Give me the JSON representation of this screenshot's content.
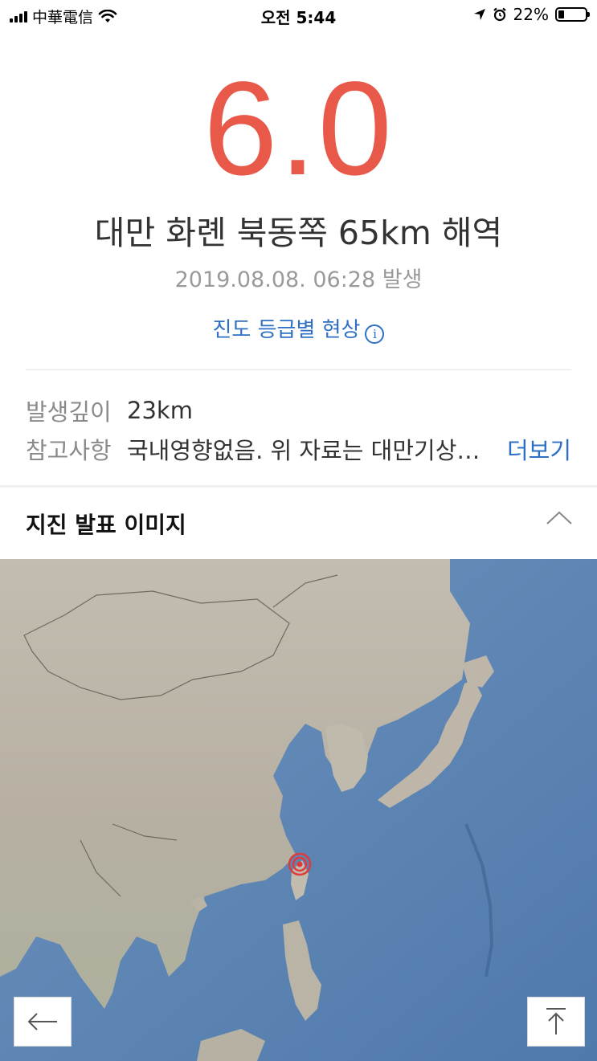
{
  "status_bar": {
    "carrier": "中華電信",
    "time": "오전 5:44",
    "battery": "22%",
    "battery_level": 0.22
  },
  "quake": {
    "magnitude": "6.0",
    "location": "대만 화롄 북동쪽 65km 해역",
    "occurred": "2019.08.08. 06:28 발생",
    "intensity_link": "진도 등급별 현상"
  },
  "details": {
    "depth_label": "발생깊이",
    "depth_value": "23km",
    "note_label": "참고사항",
    "note_value": "국내영향없음. 위 자료는 대만기상국 자료를 인용한 것입니다.",
    "more_label": "더보기"
  },
  "section": {
    "title": "지진 발표 이미지"
  },
  "colors": {
    "magnitude": "#e8594a",
    "link": "#2f6fc4",
    "land": "#b9b2a4",
    "sea": "#5b86b5",
    "epicenter": "#e03a3a"
  },
  "icons": {
    "collapse": "chevron-up-icon",
    "back": "arrow-left-icon",
    "top": "arrow-up-to-top-icon"
  }
}
